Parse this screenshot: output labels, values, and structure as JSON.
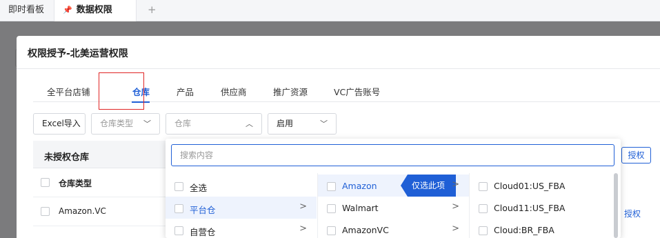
{
  "tabs": {
    "items": [
      "即时看板",
      "数据权限"
    ],
    "pin_icon": "pin-icon",
    "add_label": "+"
  },
  "background": {
    "search_placeholder": "",
    "reset_label": ""
  },
  "modal": {
    "title": "权限授予-北美运营权限",
    "subtabs": [
      "全平台店铺",
      "仓库",
      "产品",
      "供应商",
      "推广资源",
      "VC广告账号"
    ],
    "active_subtab": "仓库"
  },
  "toolbar": {
    "excel_label": "Excel导入",
    "warehouse_type_placeholder": "仓库类型",
    "warehouse_placeholder": "仓库",
    "status_value": "启用"
  },
  "table": {
    "title": "未授权仓库",
    "authorize_button": "授权",
    "column_header": "仓库类型",
    "rows": [
      "Amazon.VC"
    ],
    "row_action": "授权"
  },
  "cascader": {
    "search_placeholder": "搜索内容",
    "col1": [
      {
        "label": "全选",
        "has_child": false
      },
      {
        "label": "平台仓",
        "has_child": true,
        "selected": true
      },
      {
        "label": "自营仓",
        "has_child": true
      }
    ],
    "col2": [
      {
        "label": "Amazon",
        "has_child": true,
        "selected": true
      },
      {
        "label": "Walmart",
        "has_child": true
      },
      {
        "label": "AmazonVC",
        "has_child": true
      }
    ],
    "only_select_label": "仅选此项",
    "col3": [
      {
        "label": "Cloud01:US_FBA"
      },
      {
        "label": "Cloud11:US_FBA"
      },
      {
        "label": "Cloud:BR_FBA"
      }
    ]
  },
  "colors": {
    "accent": "#1f5fd6",
    "highlight_box": "#e02424",
    "overlay": "#7b7b7d"
  }
}
